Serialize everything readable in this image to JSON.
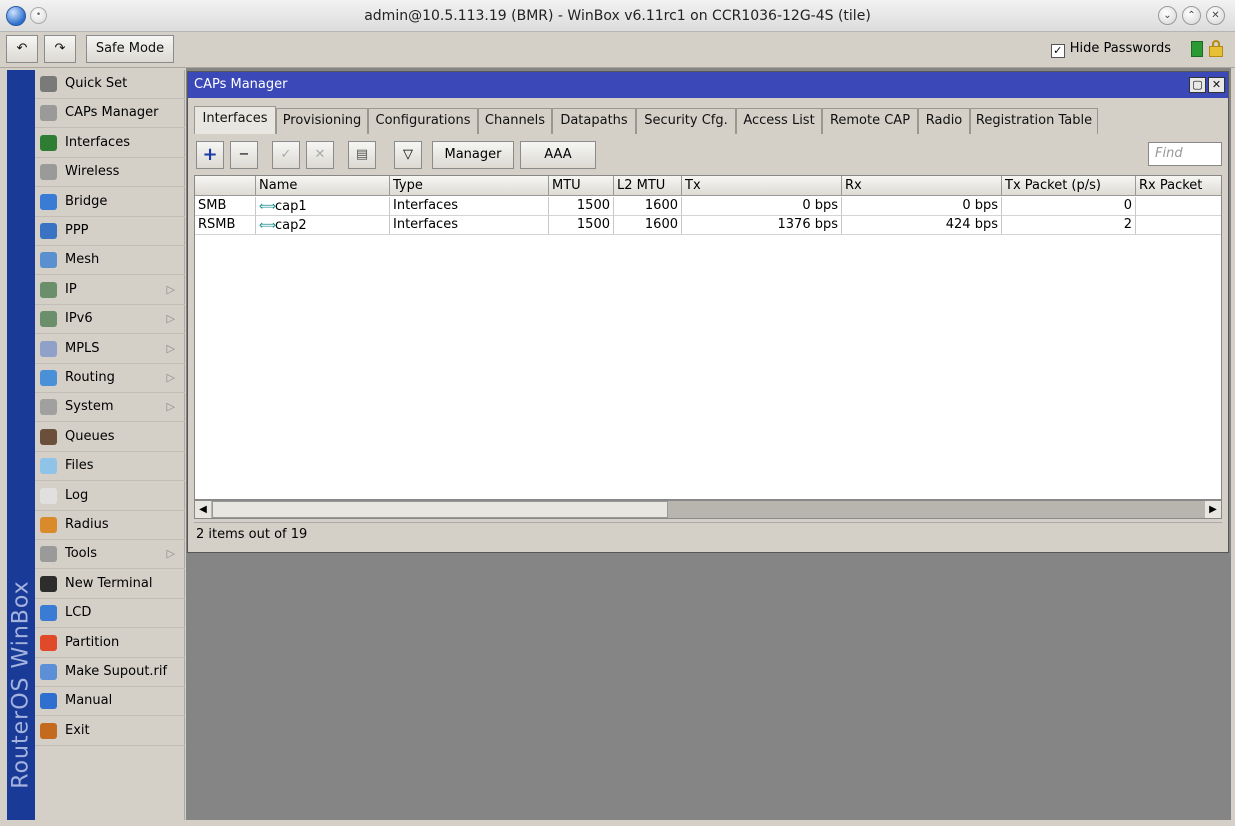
{
  "window": {
    "title": "admin@10.5.113.19 (BMR) - WinBox v6.11rc1 on CCR1036-12G-4S (tile)",
    "controls": [
      "minimize",
      "maximize",
      "close"
    ]
  },
  "toolbar": {
    "undo_icon": "undo-icon",
    "redo_icon": "redo-icon",
    "safe_mode_label": "Safe Mode",
    "hide_passwords_label": "Hide Passwords",
    "hide_passwords_checked": true
  },
  "sidebar": {
    "brand": "RouterOS WinBox",
    "items": [
      {
        "label": "Quick Set",
        "icon": "quick-set-icon",
        "submenu": false,
        "color": "#7a7a7a"
      },
      {
        "label": "CAPs Manager",
        "icon": "antenna-icon",
        "submenu": false,
        "color": "#9a9a9a"
      },
      {
        "label": "Interfaces",
        "icon": "interfaces-icon",
        "submenu": false,
        "color": "#2e7d32"
      },
      {
        "label": "Wireless",
        "icon": "antenna-icon",
        "submenu": false,
        "color": "#9a9a9a"
      },
      {
        "label": "Bridge",
        "icon": "bridge-icon",
        "submenu": false,
        "color": "#3a7bd5"
      },
      {
        "label": "PPP",
        "icon": "ppp-icon",
        "submenu": false,
        "color": "#3b73c4"
      },
      {
        "label": "Mesh",
        "icon": "mesh-icon",
        "submenu": false,
        "color": "#5a8fd0"
      },
      {
        "label": "IP",
        "icon": "ip-icon",
        "submenu": true,
        "color": "#6b8f6b"
      },
      {
        "label": "IPv6",
        "icon": "ipv6-icon",
        "submenu": true,
        "color": "#6b8f6b"
      },
      {
        "label": "MPLS",
        "icon": "mpls-icon",
        "submenu": true,
        "color": "#8fa1c8"
      },
      {
        "label": "Routing",
        "icon": "routing-icon",
        "submenu": true,
        "color": "#4a90d9"
      },
      {
        "label": "System",
        "icon": "gear-icon",
        "submenu": true,
        "color": "#a0a0a0"
      },
      {
        "label": "Queues",
        "icon": "queues-icon",
        "submenu": false,
        "color": "#6b4f3a"
      },
      {
        "label": "Files",
        "icon": "folder-icon",
        "submenu": false,
        "color": "#8fc4e8"
      },
      {
        "label": "Log",
        "icon": "log-icon",
        "submenu": false,
        "color": "#e0e0e0"
      },
      {
        "label": "Radius",
        "icon": "radius-icon",
        "submenu": false,
        "color": "#d98b2b"
      },
      {
        "label": "Tools",
        "icon": "tools-icon",
        "submenu": true,
        "color": "#9a9a9a"
      },
      {
        "label": "New Terminal",
        "icon": "terminal-icon",
        "submenu": false,
        "color": "#2d2d2d"
      },
      {
        "label": "LCD",
        "icon": "lcd-icon",
        "submenu": false,
        "color": "#3a7bd5"
      },
      {
        "label": "Partition",
        "icon": "partition-icon",
        "submenu": false,
        "color": "#e04a2b"
      },
      {
        "label": "Make Supout.rif",
        "icon": "document-icon",
        "submenu": false,
        "color": "#5c8fd6"
      },
      {
        "label": "Manual",
        "icon": "help-icon",
        "submenu": false,
        "color": "#2f6fd0"
      },
      {
        "label": "Exit",
        "icon": "exit-icon",
        "submenu": false,
        "color": "#c46a1f"
      }
    ]
  },
  "caps_window": {
    "title": "CAPs Manager",
    "tabs": [
      "Interfaces",
      "Provisioning",
      "Configurations",
      "Channels",
      "Datapaths",
      "Security Cfg.",
      "Access List",
      "Remote CAP",
      "Radio",
      "Registration Table"
    ],
    "active_tab": "Interfaces",
    "buttons": {
      "manager": "Manager",
      "aaa": "AAA"
    },
    "find_placeholder": "Find",
    "columns": [
      "",
      "Name",
      "Type",
      "MTU",
      "L2 MTU",
      "Tx",
      "Rx",
      "Tx Packet (p/s)",
      "Rx Packet"
    ],
    "rows": [
      {
        "flags": "SMB",
        "name": "cap1",
        "type": "Interfaces",
        "mtu": "1500",
        "l2mtu": "1600",
        "tx": "0 bps",
        "rx": "0 bps",
        "tx_packet": "0",
        "rx_packet": ""
      },
      {
        "flags": "RSMB",
        "name": "cap2",
        "type": "Interfaces",
        "mtu": "1500",
        "l2mtu": "1600",
        "tx": "1376 bps",
        "rx": "424 bps",
        "tx_packet": "2",
        "rx_packet": ""
      }
    ],
    "status": "2 items out of 19"
  }
}
